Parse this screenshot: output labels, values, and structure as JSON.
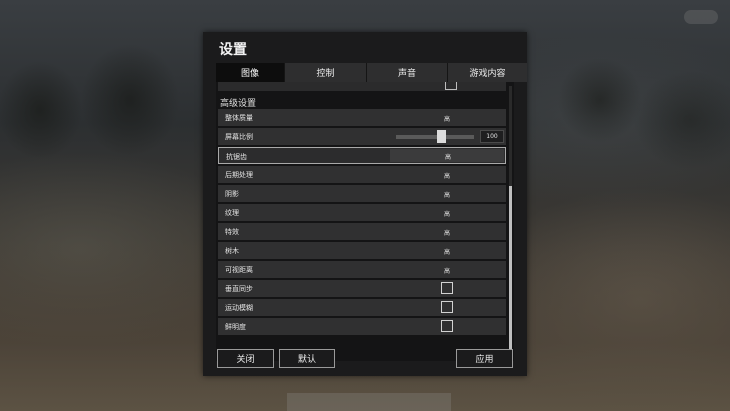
{
  "window": {
    "title": "设置"
  },
  "tabs": [
    {
      "label": "图像",
      "active": true
    },
    {
      "label": "控制",
      "active": false
    },
    {
      "label": "声音",
      "active": false
    },
    {
      "label": "游戏内容",
      "active": false
    }
  ],
  "section": {
    "title": "高级设置"
  },
  "settings": [
    {
      "label": "整体质量",
      "value": "高"
    },
    {
      "label": "屏幕比例",
      "slider_value": "100",
      "slider_fraction": 0.5
    },
    {
      "label": "抗锯齿",
      "value": "高",
      "selected": true
    },
    {
      "label": "后期处理",
      "value": "高"
    },
    {
      "label": "阴影",
      "value": "高"
    },
    {
      "label": "纹理",
      "value": "高"
    },
    {
      "label": "特效",
      "value": "高"
    },
    {
      "label": "树木",
      "value": "高"
    },
    {
      "label": "可视距离",
      "value": "高"
    },
    {
      "label": "垂直同步",
      "checked": false
    },
    {
      "label": "运动模糊",
      "checked": false
    },
    {
      "label": "鲜明度",
      "checked": false
    }
  ],
  "footer": {
    "close_label": "关闭",
    "default_label": "默认",
    "apply_label": "应用"
  },
  "colors": {
    "panel_bg": "#1b1b1c",
    "row_bg": "#303031",
    "active_tab_bg": "#0d0d0d"
  }
}
